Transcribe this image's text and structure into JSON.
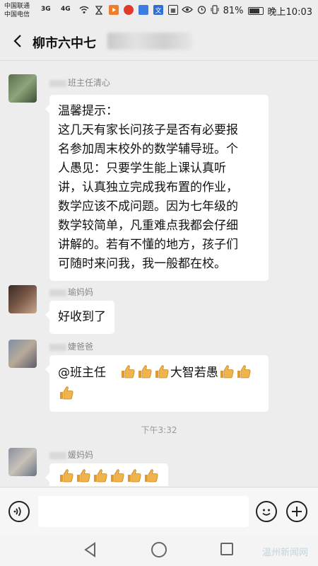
{
  "status_bar": {
    "carrier_1": "中国联通",
    "carrier_2": "中国电信",
    "sig_1": "3G",
    "sig_2": "4G",
    "battery_percent": "81%",
    "battery_level": 0.81,
    "time": "晚上10:03"
  },
  "header": {
    "title": "柳市六中七"
  },
  "messages": [
    {
      "sender": "班主任清心",
      "text_lines": [
        "温馨提示：",
        "这几天有家长问孩子是否有必要报",
        "名参加周末校外的数学辅导班。个",
        "人愚见：只要学生能上课认真听",
        "讲，认真独立完成我布置的作业，",
        "数学应该不成问题。因为七年级的",
        "数学较简单，凡重难点我都会仔细",
        "讲解的。若有不懂的地方，孩子们",
        "可随时来问我，我一般都在校。"
      ]
    },
    {
      "sender": "瑜妈妈",
      "text": "好收到了"
    },
    {
      "sender": "婕爸爸",
      "mention": "@班主任",
      "phrase": "大智若愚"
    },
    {
      "sender": "媛妈妈"
    }
  ],
  "time_divider": "下午3:32",
  "input_bar": {
    "placeholder": ""
  },
  "watermark": "温州新闻网",
  "colors": {
    "background": "#ededed",
    "bubble": "#ffffff",
    "thumb": "#f0b44c"
  }
}
